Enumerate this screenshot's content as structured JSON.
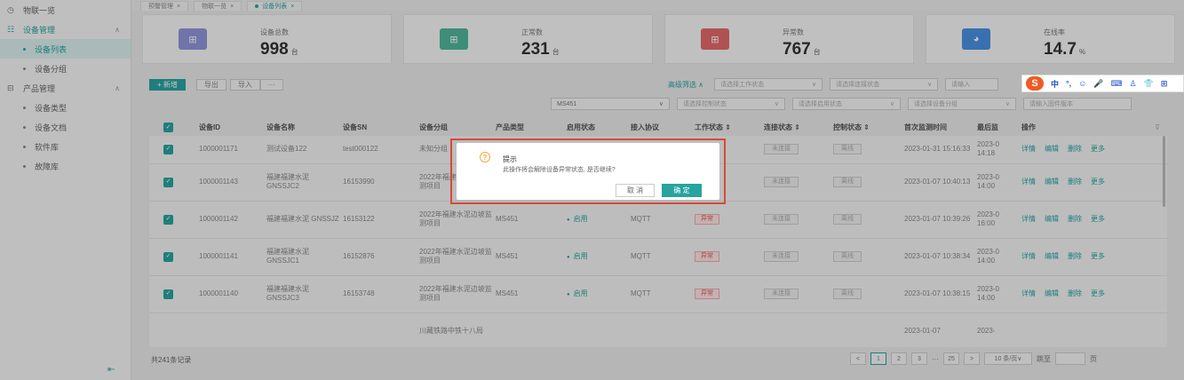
{
  "tabs": [
    {
      "label": "预警管理"
    },
    {
      "label": "物联一览"
    },
    {
      "label": "设备列表"
    }
  ],
  "sidebar": {
    "items": [
      {
        "label": "物联一览",
        "icon": "clock-icon"
      },
      {
        "label": "设备管理",
        "icon": "device-icon"
      },
      {
        "label": "设备列表"
      },
      {
        "label": "设备分组"
      },
      {
        "label": "产品管理",
        "icon": "product-icon"
      },
      {
        "label": "设备类型"
      },
      {
        "label": "设备文档"
      },
      {
        "label": "软件库"
      },
      {
        "label": "故障库"
      }
    ]
  },
  "stats": [
    {
      "label": "设备总数",
      "value": "998",
      "unit": "台",
      "color": "#8f95d9",
      "icon": "router-icon"
    },
    {
      "label": "正常数",
      "value": "231",
      "unit": "台",
      "color": "#4fb59a",
      "icon": "router-icon"
    },
    {
      "label": "异常数",
      "value": "767",
      "unit": "台",
      "color": "#e26a6a",
      "icon": "router-icon"
    },
    {
      "label": "在线率",
      "value": "14.7",
      "unit": "%",
      "color": "#4a90e2",
      "icon": "pie-icon"
    }
  ],
  "toolbar": {
    "add": "+ 新增",
    "export": "导出",
    "import": "导入",
    "more": "···"
  },
  "filters": {
    "advanced": "高级筛选 ∧",
    "work_status": "请选择工作状态",
    "connect_status": "请选择连接状态",
    "input_placeholder": "请输入",
    "model": "MS451",
    "control_status": "请选择控制状态",
    "enable_status": "请选择启用状态",
    "group": "请选择设备分组",
    "firmware": "请输入固件版本"
  },
  "ime": {
    "logo": "S",
    "items": [
      "中",
      "°,",
      "☺",
      "🎤",
      "⌨",
      "♙",
      "👕",
      "⊞"
    ]
  },
  "table": {
    "headers": [
      "设备ID",
      "设备名称",
      "设备SN",
      "设备分组",
      "产品类型",
      "启用状态",
      "接入协议",
      "工作状态 ⇕",
      "连接状态 ⇕",
      "控制状态 ⇕",
      "首次监测时间",
      "最后监",
      "操作"
    ],
    "rows": [
      {
        "id": "1000001171",
        "name": "测试设备122",
        "sn": "test000122",
        "group": "未知分组",
        "type": "",
        "enabled": "",
        "protocol": "",
        "work": "",
        "conn": "未连接",
        "ctrl": "离线",
        "first": "2023-01-31 15:16:33",
        "last": "2023-0 14:18"
      },
      {
        "id": "1000001143",
        "name": "福建福建水泥 GNSSJC2",
        "sn": "16153990",
        "group": "2022年福建水泥边坡监测项目",
        "type": "",
        "enabled": "",
        "protocol": "",
        "work": "",
        "conn": "未连接",
        "ctrl": "离线",
        "first": "2023-01-07 10:40:13",
        "last": "2023-0 14:00"
      },
      {
        "id": "1000001142",
        "name": "福建福建水泥 GNSSJZ",
        "sn": "16153122",
        "group": "2022年福建水泥边坡监测项目",
        "type": "MS451",
        "enabled": "启用",
        "protocol": "MQTT",
        "work": "异常",
        "conn": "未连接",
        "ctrl": "离线",
        "first": "2023-01-07 10:39:26",
        "last": "2023-0 16:00"
      },
      {
        "id": "1000001141",
        "name": "福建福建水泥 GNSSJC1",
        "sn": "16152876",
        "group": "2022年福建水泥边坡监测项目",
        "type": "MS451",
        "enabled": "启用",
        "protocol": "MQTT",
        "work": "异常",
        "conn": "未连接",
        "ctrl": "离线",
        "first": "2023-01-07 10:38:34",
        "last": "2023-0 14:00"
      },
      {
        "id": "1000001140",
        "name": "福建福建水泥 GNSSJC3",
        "sn": "16153748",
        "group": "2022年福建水泥边坡监测项目",
        "type": "MS451",
        "enabled": "启用",
        "protocol": "MQTT",
        "work": "异常",
        "conn": "未连接",
        "ctrl": "离线",
        "first": "2023-01-07 10:38:15",
        "last": "2023-0 14:00"
      },
      {
        "id": "",
        "name": "",
        "sn": "",
        "group": "川藏铁路中铁十八局",
        "type": "",
        "enabled": "",
        "protocol": "",
        "work": "",
        "conn": "",
        "ctrl": "",
        "first": "2023-01-07",
        "last": "2023-"
      }
    ],
    "ops": [
      "详情",
      "编辑",
      "删除",
      "更多"
    ]
  },
  "footer": {
    "total": "共241条记录",
    "pages": [
      "<",
      "1",
      "2",
      "3",
      "···",
      "25",
      ">"
    ],
    "page_size": "10 条/页∨",
    "jump_label": "跳至",
    "page_suffix": "页"
  },
  "dialog": {
    "title": "提示",
    "message": "此操作将会解除设备异常状态, 是否继续?",
    "cancel": "取 消",
    "ok": "确 定"
  }
}
